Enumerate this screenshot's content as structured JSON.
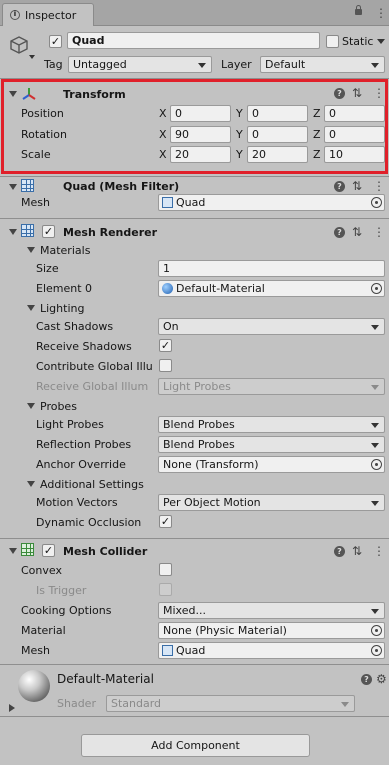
{
  "window": {
    "tab_title": "Inspector"
  },
  "gameobject": {
    "name": "Quad",
    "active": true,
    "static_label": "Static",
    "tag_label": "Tag",
    "tag_value": "Untagged",
    "layer_label": "Layer",
    "layer_value": "Default"
  },
  "transform": {
    "title": "Transform",
    "position": {
      "label": "Position",
      "x": "0",
      "y": "0",
      "z": "0"
    },
    "rotation": {
      "label": "Rotation",
      "x": "90",
      "y": "0",
      "z": "0"
    },
    "scale": {
      "label": "Scale",
      "x": "20",
      "y": "20",
      "z": "10"
    },
    "axis_x": "X",
    "axis_y": "Y",
    "axis_z": "Z",
    "highlight_color": "#e0202a"
  },
  "mesh_filter": {
    "title": "Quad (Mesh Filter)",
    "mesh_label": "Mesh",
    "mesh_value": "Quad"
  },
  "mesh_renderer": {
    "title": "Mesh Renderer",
    "enabled": true,
    "materials_label": "Materials",
    "size_label": "Size",
    "size_value": "1",
    "element0_label": "Element 0",
    "element0_value": "Default-Material",
    "lighting_label": "Lighting",
    "cast_shadows_label": "Cast Shadows",
    "cast_shadows_value": "On",
    "receive_shadows_label": "Receive Shadows",
    "receive_shadows_checked": true,
    "contribute_gi_label": "Contribute Global Illu",
    "contribute_gi_checked": false,
    "receive_gi_label": "Receive Global Illum",
    "receive_gi_value": "Light Probes",
    "probes_label": "Probes",
    "light_probes_label": "Light Probes",
    "light_probes_value": "Blend Probes",
    "reflection_probes_label": "Reflection Probes",
    "reflection_probes_value": "Blend Probes",
    "anchor_override_label": "Anchor Override",
    "anchor_override_value": "None (Transform)",
    "additional_settings_label": "Additional Settings",
    "motion_vectors_label": "Motion Vectors",
    "motion_vectors_value": "Per Object Motion",
    "dynamic_occlusion_label": "Dynamic Occlusion",
    "dynamic_occlusion_checked": true
  },
  "mesh_collider": {
    "title": "Mesh Collider",
    "enabled": true,
    "convex_label": "Convex",
    "is_trigger_label": "Is Trigger",
    "cooking_options_label": "Cooking Options",
    "cooking_options_value": "Mixed...",
    "material_label": "Material",
    "material_value": "None (Physic Material)",
    "mesh_label": "Mesh",
    "mesh_value": "Quad"
  },
  "material": {
    "name": "Default-Material",
    "shader_label": "Shader",
    "shader_value": "Standard"
  },
  "add_component_label": "Add Component",
  "glyphs": {
    "check": "✓",
    "help": "?",
    "settings": "⇅",
    "menu": "⋮",
    "lock": "🔒",
    "gear": "⚙",
    "cube": "⬡"
  }
}
